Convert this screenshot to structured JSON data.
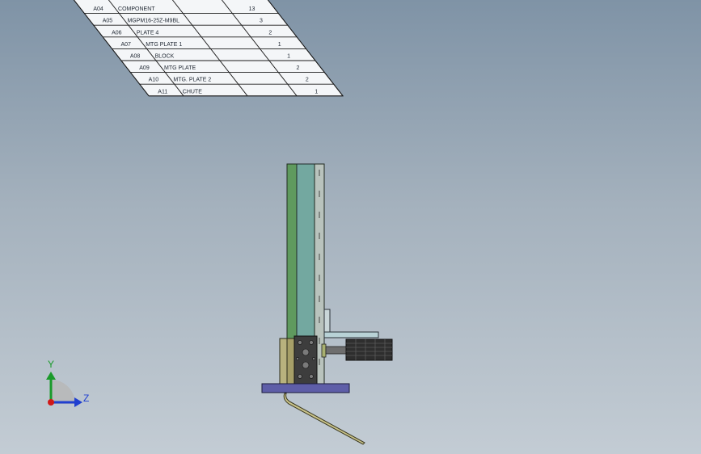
{
  "bom": {
    "rows": [
      {
        "item": "A04",
        "name": "COMPONENT",
        "qty": "13"
      },
      {
        "item": "A05",
        "name": "MGPM16-25Z-M9BL",
        "qty": "3"
      },
      {
        "item": "A06",
        "name": "PLATE 4",
        "qty": "2"
      },
      {
        "item": "A07",
        "name": "MTG PLATE 1",
        "qty": "1"
      },
      {
        "item": "A08",
        "name": "BLOCK",
        "qty": "1"
      },
      {
        "item": "A09",
        "name": "MTG PLATE",
        "qty": "2"
      },
      {
        "item": "A10",
        "name": "MTG. PLATE 2",
        "qty": "2"
      },
      {
        "item": "A11",
        "name": "CHUTE",
        "qty": "1"
      }
    ]
  },
  "triad": {
    "y_label": "Y",
    "z_label": "Z",
    "y_color": "#1a9a2a",
    "z_color": "#1f3fd0",
    "origin_color": "#d01818"
  },
  "colors": {
    "background_top": "#7f93a6",
    "background_bottom": "#c3ccd4"
  }
}
